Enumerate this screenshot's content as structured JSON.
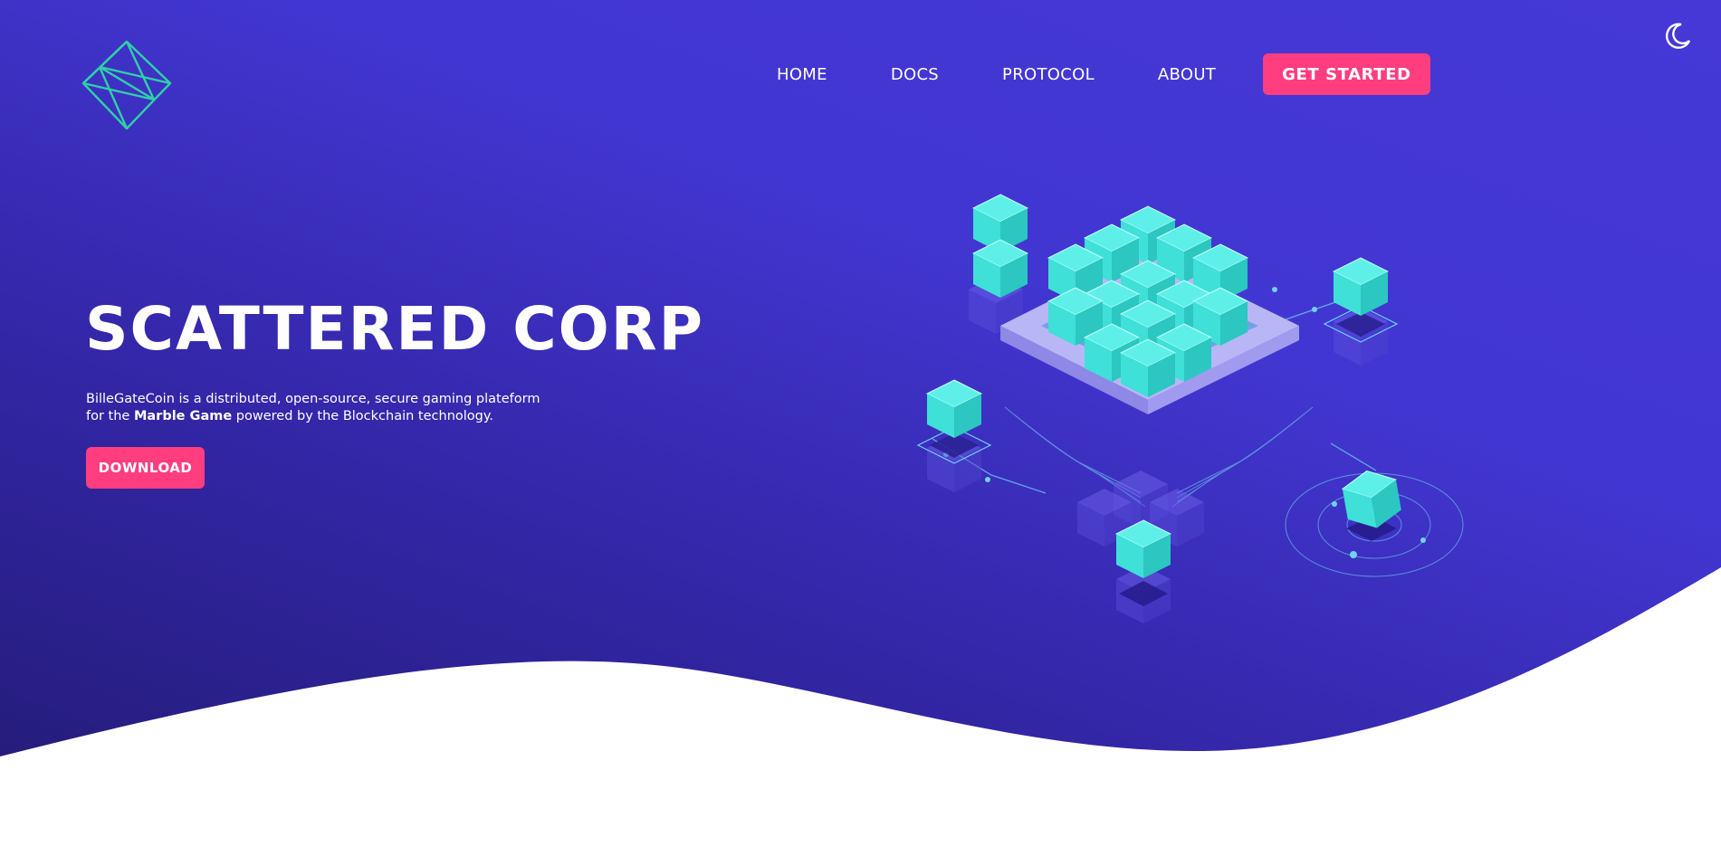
{
  "header": {
    "logo_icon": "octahedron-logo-icon",
    "theme_toggle_icon": "moon-icon"
  },
  "nav": {
    "items": [
      {
        "label": "HOME"
      },
      {
        "label": "DOCS"
      },
      {
        "label": "PROTOCOL"
      },
      {
        "label": "ABOUT"
      }
    ],
    "cta_label": "GET STARTED"
  },
  "hero": {
    "title": "SCATTERED CORP",
    "description_lead": "BilleGateCoin is a distributed, open-source, secure gaming plateform for the ",
    "description_bold": "Marble Game",
    "description_tail": " powered by the Blockchain technology.",
    "download_label": "DOWNLOAD",
    "illustration_icon": "blockchain-cubes-illustration"
  },
  "colors": {
    "background": "#4538d6",
    "background_dark": "#221a72",
    "accent": "#ff3d7f",
    "cube": "#3ee0d8",
    "logo_stroke": "#2fd0a8"
  }
}
